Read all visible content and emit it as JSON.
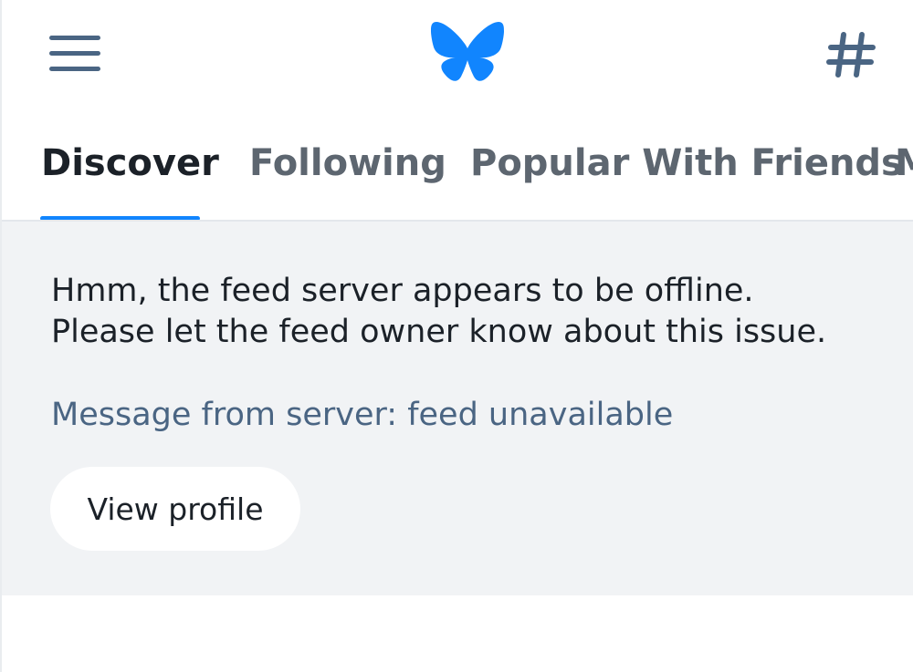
{
  "header": {
    "menu_icon": "hamburger-menu-icon",
    "logo_icon": "butterfly-logo-icon",
    "hash_icon": "hashtag-icon",
    "brand_color": "#1185fe"
  },
  "tabs": [
    {
      "label": "Discover",
      "active": true
    },
    {
      "label": "Following",
      "active": false
    },
    {
      "label": "Popular With Friends",
      "active": false
    },
    {
      "label": "M",
      "active": false
    }
  ],
  "feed_error": {
    "message_line1": "Hmm, the feed server appears to be offline.",
    "message_line2": "Please let the feed owner know about this issue.",
    "server_message": "Message from server: feed unavailable",
    "view_profile_label": "View profile"
  }
}
